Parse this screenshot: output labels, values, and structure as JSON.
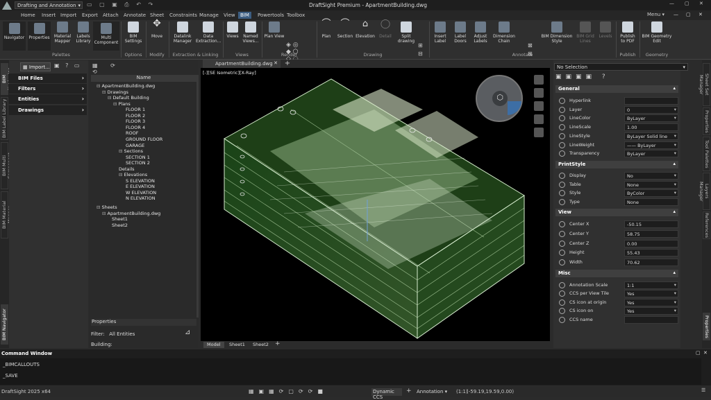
{
  "title": {
    "workspace": "Drafting and Annotation",
    "window_title": "DraftSight Premium - ApartmentBuilding.dwg",
    "menu_label": "Menu"
  },
  "menu_tabs": [
    "Home",
    "Insert",
    "Import",
    "Export",
    "Attach",
    "Annotate",
    "Sheet",
    "Constraints",
    "Manage",
    "View",
    "BIM",
    "Powertools",
    "Toolbox"
  ],
  "ribbon": {
    "buttons": {
      "navigator": "Navigator",
      "properties": "Properties",
      "material_mapper": "Material\nMapper",
      "labels_library": "Labels\nLibrary",
      "multi_component": "Multi\nComponent",
      "bim_settings": "BIM\nSettings",
      "move": "Move",
      "datalink_manager": "Datalink\nManager",
      "data_extraction": "Data\nExtraction...",
      "views": "Views",
      "named_views": "Named\nViews...",
      "plan_view": "Plan View",
      "plan": "Plan",
      "section": "Section",
      "elevation": "Elevation",
      "detail": "Detail",
      "split_drawing": "Split\ndrawing",
      "insert_label": "Insert\nLabel",
      "label_doors": "Label\nDoors",
      "adjust_labels": "Adjust\nLabels",
      "dimension_chain": "Dimension\nChain",
      "bim_dimension_style": "BIM Dimension\nStyle",
      "bim_grid_lines": "BIM Grid\nLines",
      "levels": "Levels",
      "publish_pdf": "Publish\nto PDF",
      "bim_geometry_edit": "BIM Geometry\nEdit"
    },
    "groups": {
      "palettes": "Palettes",
      "options": "Options",
      "modify": "Modify",
      "extraction": "Extraction & Linking",
      "views": "Views",
      "render": "Render",
      "drawing": "Drawing",
      "annotate": "Annotate",
      "publish": "Publish",
      "geometry": "Geometry"
    }
  },
  "left_tabs": [
    "BIM Navigator",
    "BIM Label Library",
    "BIM Multi Component",
    "BIM Material Mapper"
  ],
  "left_tab_bottom": "BIM Navigator",
  "bim_panel": {
    "import": "Import...",
    "rows": [
      "BIM Files",
      "Filters",
      "Entities",
      "Drawings"
    ]
  },
  "tree": {
    "column_header": "Name",
    "items": [
      {
        "label": "ApartmentBuilding.dwg",
        "x": 8,
        "toggle": "⊟"
      },
      {
        "label": "Drawings",
        "x": 16,
        "toggle": "⊟"
      },
      {
        "label": "Default Building",
        "x": 24,
        "toggle": "⊟"
      },
      {
        "label": "Plans",
        "x": 32,
        "toggle": "⊟"
      },
      {
        "label": "FLOOR 1",
        "x": 50
      },
      {
        "label": "FLOOR 2",
        "x": 50
      },
      {
        "label": "FLOOR 3",
        "x": 50
      },
      {
        "label": "FLOOR 4",
        "x": 50
      },
      {
        "label": "ROOF",
        "x": 50
      },
      {
        "label": "GROUND FLOOR",
        "x": 50
      },
      {
        "label": "GARAGE",
        "x": 50
      },
      {
        "label": "Sections",
        "x": 40,
        "toggle": "⊟"
      },
      {
        "label": "SECTION 1",
        "x": 50
      },
      {
        "label": "SECTION 2",
        "x": 50
      },
      {
        "label": "Details",
        "x": 40
      },
      {
        "label": "Elevations",
        "x": 40,
        "toggle": "⊟"
      },
      {
        "label": "S ELEVATION",
        "x": 50
      },
      {
        "label": "E ELEVATION",
        "x": 50
      },
      {
        "label": "W ELEVATION",
        "x": 50
      },
      {
        "label": "N ELEVATION",
        "x": 50
      },
      {
        "label": "Sheets",
        "x": 8,
        "toggle": "⊟",
        "gap": true
      },
      {
        "label": "ApartmentBuilding.dwg",
        "x": 16,
        "toggle": "⊟"
      },
      {
        "label": "Sheet1",
        "x": 30
      },
      {
        "label": "Sheet2",
        "x": 30
      }
    ],
    "properties_label": "Properties",
    "filter_label": "Filter:",
    "filter_value": "All Entities",
    "building_label": "Building:"
  },
  "viewport": {
    "doc_tab": "ApartmentBuilding.dwg",
    "view_label": "[-][SE Isometric][X-Ray]",
    "sheet_tabs": [
      "Model",
      "Sheet1",
      "Sheet2"
    ]
  },
  "properties": {
    "selection": "No Selection",
    "general_title": "General",
    "general": [
      {
        "label": "Hyperlink",
        "value": ""
      },
      {
        "label": "Layer",
        "value": "0",
        "dd": true
      },
      {
        "label": "LineColor",
        "value": "ByLayer",
        "dd": true
      },
      {
        "label": "LineScale",
        "value": "1.00"
      },
      {
        "label": "LineStyle",
        "value": "ByLayer      Solid line",
        "dd": true
      },
      {
        "label": "LineWeight",
        "value": "—— ByLayer",
        "dd": true
      },
      {
        "label": "Transparency",
        "value": "ByLayer",
        "dd": true
      }
    ],
    "printstyle_title": "PrintStyle",
    "printstyle": [
      {
        "label": "Display",
        "value": "No",
        "dd": true
      },
      {
        "label": "Table",
        "value": "None",
        "dd": true
      },
      {
        "label": "Style",
        "value": "ByColor",
        "dd": true
      },
      {
        "label": "Type",
        "value": "None"
      }
    ],
    "view_title": "View",
    "view": [
      {
        "label": "Center X",
        "value": "-50.15"
      },
      {
        "label": "Center Y",
        "value": "58.75"
      },
      {
        "label": "Center Z",
        "value": "0.00"
      },
      {
        "label": "Height",
        "value": "55.43"
      },
      {
        "label": "Width",
        "value": "70.62"
      }
    ],
    "misc_title": "Misc",
    "misc": [
      {
        "label": "Annotation Scale",
        "value": "1:1",
        "dd": true
      },
      {
        "label": "CCS per View Tile",
        "value": "Yes",
        "dd": true
      },
      {
        "label": "CS icon at origin",
        "value": "Yes",
        "dd": true
      },
      {
        "label": "CS icon on",
        "value": "Yes",
        "dd": true
      },
      {
        "label": "CCS name",
        "value": ""
      }
    ]
  },
  "right_tabs": [
    "Sheet Set Manager",
    "Properties",
    "Tool Palettes",
    "Layers Manager",
    "References"
  ],
  "right_tab_bottom": "Properties",
  "command": {
    "title": "Command Window",
    "lines": [
      "_BIMCALLOUTS",
      "_SAVE"
    ]
  },
  "status": {
    "app": "DraftSight 2025 x64",
    "ccs": "Dynamic CCS",
    "annotation": "Annotation",
    "scale": "(1:1)",
    "coords": "(-59.19,19.59,0.00)"
  }
}
